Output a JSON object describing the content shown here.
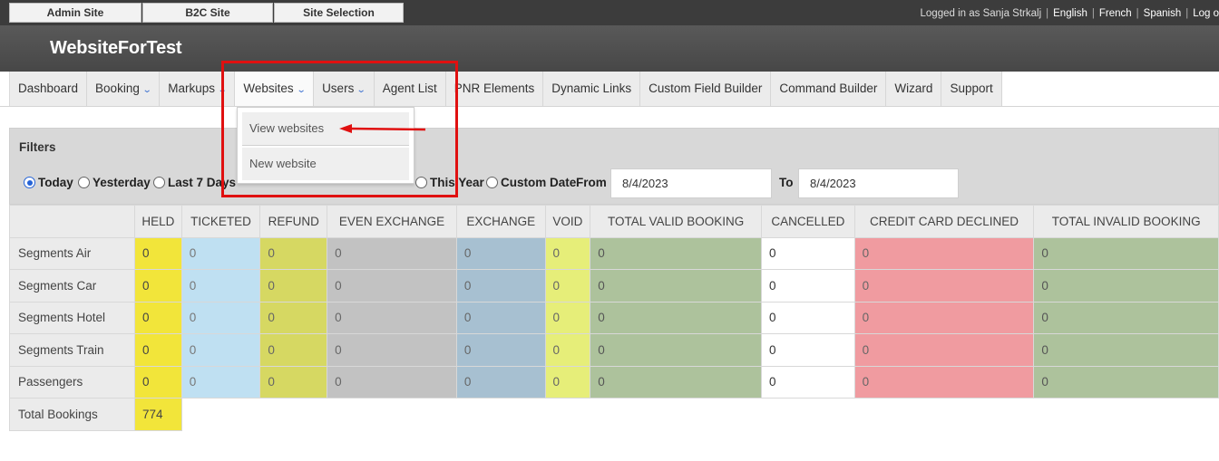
{
  "top_tabs": [
    "Admin Site",
    "B2C Site",
    "Site Selection"
  ],
  "top_right": {
    "logged_in": "Logged in as Sanja Strkalj",
    "languages": [
      "English",
      "French",
      "Spanish"
    ],
    "logout": "Log o"
  },
  "brand": "WebsiteForTest",
  "nav": {
    "items": [
      "Dashboard",
      "Booking",
      "Markups",
      "Websites",
      "Users",
      "Agent List",
      "PNR Elements",
      "Dynamic Links",
      "Custom Field Builder",
      "Command Builder",
      "Wizard",
      "Support"
    ],
    "chevron": "⌄"
  },
  "dropdown": {
    "items": [
      "View websites",
      "New website"
    ]
  },
  "filters": {
    "title": "Filters",
    "radios": [
      "Today",
      "Yesterday",
      "Last 7 Days",
      "This Year",
      "Custom Date"
    ],
    "selected": "Today",
    "from_label": "From",
    "from_value": "8/4/2023",
    "to_label": "To",
    "to_value": "8/4/2023"
  },
  "table": {
    "columns": [
      "HELD",
      "TICKETED",
      "REFUND",
      "EVEN EXCHANGE",
      "EXCHANGE",
      "VOID",
      "TOTAL VALID BOOKING",
      "CANCELLED",
      "CREDIT CARD DECLINED",
      "TOTAL INVALID BOOKING"
    ],
    "rows": [
      {
        "label": "Segments Air",
        "values": [
          "0",
          "0",
          "0",
          "0",
          "0",
          "0",
          "0",
          "0",
          "0",
          "0"
        ]
      },
      {
        "label": "Segments Car",
        "values": [
          "0",
          "0",
          "0",
          "0",
          "0",
          "0",
          "0",
          "0",
          "0",
          "0"
        ]
      },
      {
        "label": "Segments Hotel",
        "values": [
          "0",
          "0",
          "0",
          "0",
          "0",
          "0",
          "0",
          "0",
          "0",
          "0"
        ]
      },
      {
        "label": "Segments Train",
        "values": [
          "0",
          "0",
          "0",
          "0",
          "0",
          "0",
          "0",
          "0",
          "0",
          "0"
        ]
      },
      {
        "label": "Passengers",
        "values": [
          "0",
          "0",
          "0",
          "0",
          "0",
          "0",
          "0",
          "0",
          "0",
          "0"
        ]
      }
    ],
    "total_label": "Total Bookings",
    "total_value": "774"
  },
  "colors": {
    "held": "#f2e53a",
    "ticketed": "#bfe0f2",
    "refund": "#d6d862",
    "even_exchange": "#c2c2c2",
    "exchange": "#a7c0d1",
    "void": "#e6ee79",
    "total_valid": "#adc29c",
    "cancelled": "#ffffff",
    "credit_card_declined": "#f09ba0",
    "total_invalid": "#adc29c",
    "annotation": "#e01010"
  }
}
